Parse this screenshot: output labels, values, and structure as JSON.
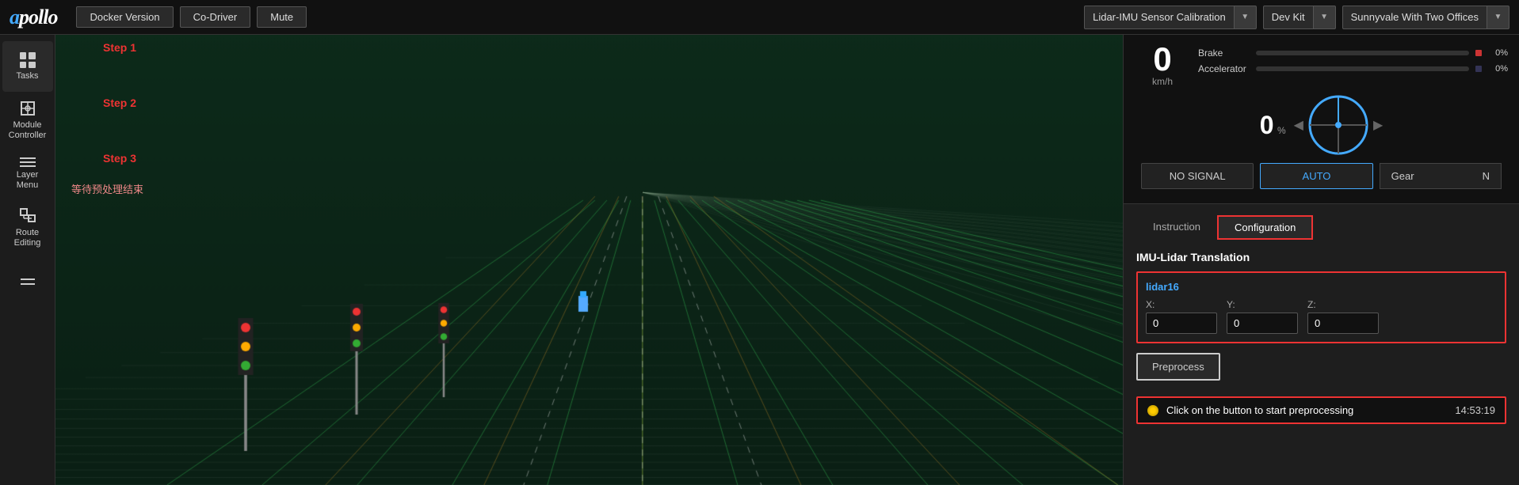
{
  "app": {
    "logo": "apollo"
  },
  "topbar": {
    "docker_version_label": "Docker Version",
    "co_driver_label": "Co-Driver",
    "mute_label": "Mute",
    "mode_dropdown": "Lidar-IMU Sensor Calibration",
    "vehicle_dropdown": "Dev Kit",
    "map_dropdown": "Sunnyvale With Two Offices"
  },
  "sidebar": {
    "items": [
      {
        "id": "tasks",
        "label": "Tasks"
      },
      {
        "id": "module-controller",
        "label": "Module\nController"
      },
      {
        "id": "layer-menu",
        "label": "Layer\nMenu"
      },
      {
        "id": "route-editing",
        "label": "Route\nEditing"
      }
    ]
  },
  "instruments": {
    "speed_value": "0",
    "speed_unit": "km/h",
    "brake_label": "Brake",
    "brake_value": "0%",
    "accelerator_label": "Accelerator",
    "accelerator_value": "0%",
    "steering_pct": "0",
    "steering_unit": "%",
    "signal_label": "NO SIGNAL",
    "auto_label": "AUTO",
    "gear_label": "Gear",
    "gear_value": "N"
  },
  "steps": {
    "step1_label": "Step 1",
    "step2_label": "Step 2",
    "step3_label": "Step 3",
    "waiting_text": "等待预处理结束"
  },
  "calibration": {
    "tab_instruction": "Instruction",
    "tab_configuration": "Configuration",
    "section_title": "IMU-Lidar Translation",
    "lidar_id": "lidar16",
    "x_label": "X:",
    "x_value": "0",
    "y_label": "Y:",
    "y_value": "0",
    "z_label": "Z:",
    "z_value": "0",
    "preprocess_label": "Preprocess",
    "status_text": "Click on the button to start preprocessing",
    "status_time": "14:53:19"
  }
}
